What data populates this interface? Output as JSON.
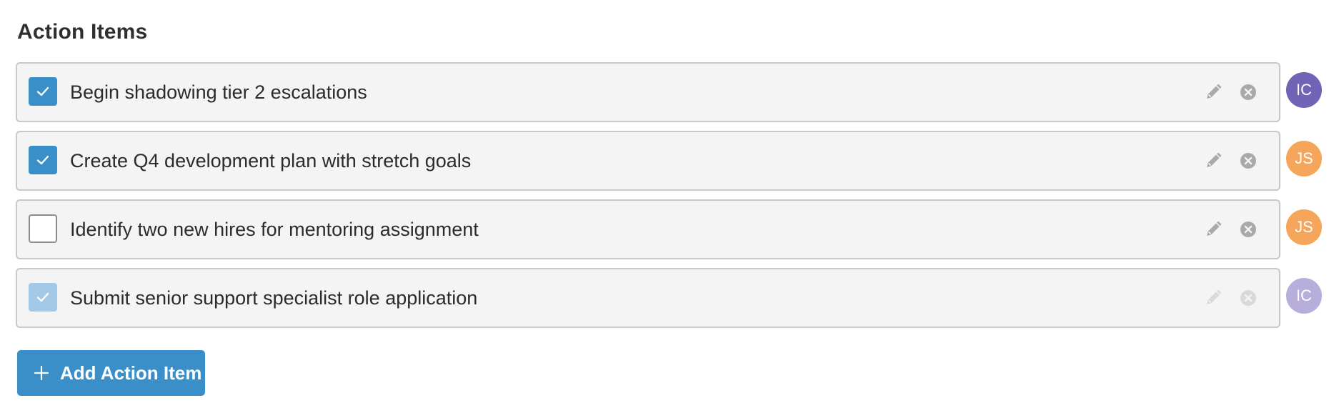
{
  "section": {
    "title": "Action Items"
  },
  "items": [
    {
      "label": "Begin shadowing tier 2 escalations",
      "checked": true,
      "muted": false,
      "assignee_initials": "IC",
      "assignee_color": "#7163b5"
    },
    {
      "label": "Create Q4 development plan with stretch goals",
      "checked": true,
      "muted": false,
      "assignee_initials": "JS",
      "assignee_color": "#f5a65b"
    },
    {
      "label": "Identify two new hires for mentoring assignment",
      "checked": false,
      "muted": false,
      "assignee_initials": "JS",
      "assignee_color": "#f5a65b"
    },
    {
      "label": "Submit senior support specialist role application",
      "checked": true,
      "muted": true,
      "assignee_initials": "IC",
      "assignee_color": "#b7aedc"
    }
  ],
  "add_button": {
    "label": "Add Action Item"
  },
  "colors": {
    "accent": "#3a8fc8",
    "card_background": "#f4f4f4",
    "card_border": "#c9c9c9",
    "icon_gray": "#a9a9a9"
  },
  "icons": {
    "edit": "pencil-icon",
    "remove": "close-circle-icon",
    "check": "checkmark-icon",
    "add": "plus-icon"
  }
}
